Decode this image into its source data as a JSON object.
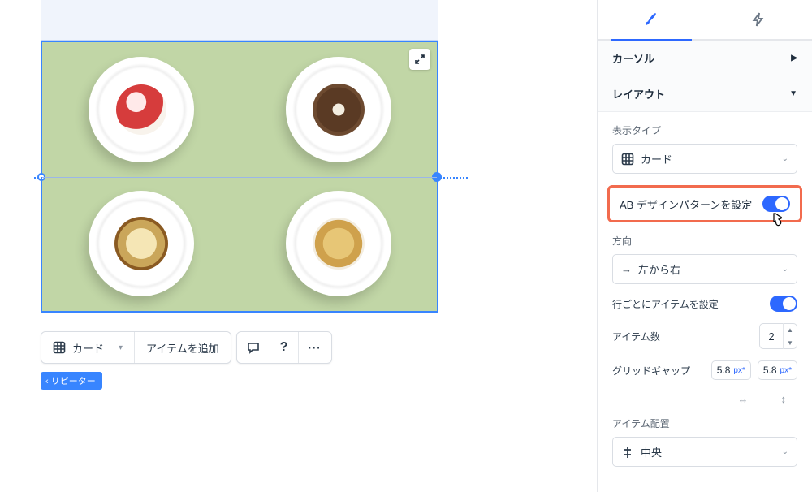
{
  "canvas": {
    "tag_label": "リピーター",
    "toolbar": {
      "card_label": "カード",
      "add_item_label": "アイテムを追加"
    }
  },
  "sidebar": {
    "accordion": {
      "cursor_label": "カーソル",
      "layout_label": "レイアウト"
    },
    "display_type": {
      "label": "表示タイプ",
      "value": "カード"
    },
    "ab_pattern": {
      "label": "AB デザインパターンを設定"
    },
    "direction": {
      "label": "方向",
      "value": "左から右"
    },
    "items_per_row": {
      "label": "行ごとにアイテムを設定"
    },
    "item_count": {
      "label": "アイテム数",
      "value": "2"
    },
    "grid_gap": {
      "label": "グリッドギャップ",
      "h_value": "5.8",
      "h_unit": "px*",
      "v_value": "5.8",
      "v_unit": "px*"
    },
    "item_align": {
      "label": "アイテム配置",
      "value": "中央"
    }
  }
}
